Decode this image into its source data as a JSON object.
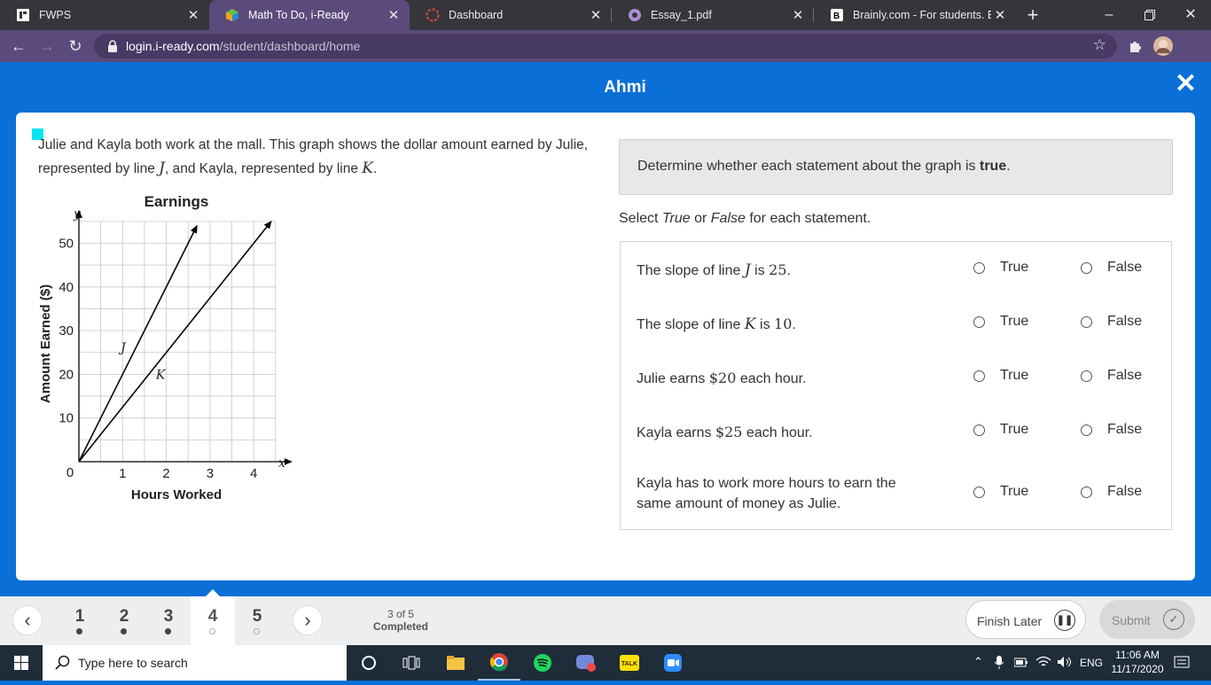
{
  "browser": {
    "tabs": [
      {
        "title": "FWPS",
        "active": false
      },
      {
        "title": "Math To Do, i-Ready",
        "active": true
      },
      {
        "title": "Dashboard",
        "active": false
      },
      {
        "title": "Essay_1.pdf",
        "active": false
      },
      {
        "title": "Brainly.com - For students. By",
        "active": false
      }
    ],
    "url_domain": "login.i-ready.com",
    "url_path": "/student/dashboard/home"
  },
  "header": {
    "title": "Ahmi",
    "close_icon": "close-icon"
  },
  "question": {
    "text_a": "Julie and Kayla both work at the mall. This graph shows the dollar amount earned by Julie, represented by line ",
    "var_j": "J",
    "text_b": ", and Kayla, represented by line ",
    "var_k": "K",
    "text_c": "."
  },
  "chart_data": {
    "type": "line",
    "title": "Earnings",
    "xlabel": "Hours Worked",
    "ylabel": "Amount Earned ($)",
    "x_axis_var": "x",
    "y_axis_var": "y",
    "xlim": [
      0,
      4.5
    ],
    "ylim": [
      0,
      55
    ],
    "x_ticks": [
      "1",
      "2",
      "3",
      "4"
    ],
    "y_ticks": [
      "10",
      "20",
      "30",
      "40",
      "50"
    ],
    "origin_label": "0",
    "grid": true,
    "series": [
      {
        "name": "J",
        "x": [
          0,
          2.7
        ],
        "y": [
          0,
          54
        ]
      },
      {
        "name": "K",
        "x": [
          0,
          4.4
        ],
        "y": [
          0,
          55
        ]
      }
    ]
  },
  "panel": {
    "instruction_prefix": "Determine whether each statement about the graph is ",
    "instruction_bold": "true",
    "instruction_suffix": ".",
    "select_a": "Select ",
    "select_true": "True",
    "select_or": " or ",
    "select_false": "False",
    "select_b": " for each statement.",
    "true_label": "True",
    "false_label": "False",
    "statements": [
      {
        "pre": "The slope of line ",
        "var": "J",
        "mid": " is ",
        "num": "25",
        "post": "."
      },
      {
        "pre": "The slope of line ",
        "var": "K",
        "mid": " is ",
        "num": "10",
        "post": "."
      },
      {
        "pre": "Julie earns ",
        "num": "$20",
        "post": " each hour."
      },
      {
        "pre": "Kayla earns ",
        "num": "$25",
        "post": " each hour."
      },
      {
        "line1": "Kayla has to work more hours to earn the",
        "line2": "same amount of money as Julie."
      }
    ]
  },
  "nav": {
    "questions": [
      "1",
      "2",
      "3",
      "4",
      "5"
    ],
    "current": 4,
    "progress_count": "3 of 5",
    "progress_label": "Completed",
    "finish_later": "Finish Later",
    "submit": "Submit"
  },
  "taskbar": {
    "search_placeholder": "Type here to search",
    "language": "ENG",
    "time": "11:06 AM",
    "date": "11/17/2020"
  },
  "colors": {
    "brand_blue": "#0a6fd6",
    "chrome_toolbar": "#5b4b7c",
    "chrome_tabstrip": "#35363a"
  }
}
